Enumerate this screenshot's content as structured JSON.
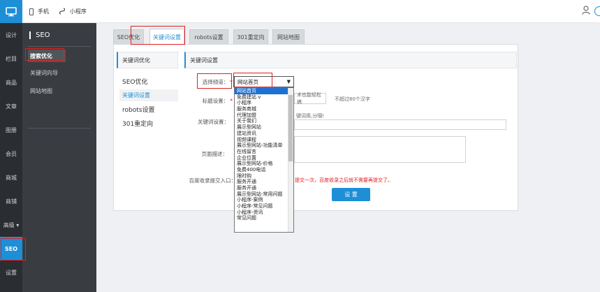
{
  "topbar": {
    "tabs": [
      {
        "label": "手机",
        "icon": "phone-icon"
      },
      {
        "label": "小程序",
        "icon": "mini-program-icon"
      }
    ]
  },
  "leftnav": {
    "items": [
      {
        "label": "设计"
      },
      {
        "label": "栏目"
      },
      {
        "label": "商品"
      },
      {
        "label": "文章"
      },
      {
        "label": "图册"
      },
      {
        "label": "会员"
      },
      {
        "label": "商城"
      },
      {
        "label": "商铺"
      },
      {
        "label": "高级 ▾"
      },
      {
        "label": "SEO"
      },
      {
        "label": "设置"
      }
    ],
    "active_index": 9
  },
  "subnav": {
    "title": "SEO",
    "items": [
      {
        "label": "搜索优化"
      },
      {
        "label": "关键词向导"
      },
      {
        "label": "网站地图"
      }
    ]
  },
  "tabs": [
    {
      "label": "SEO优化"
    },
    {
      "label": "关键词设置"
    },
    {
      "label": "robots设置"
    },
    {
      "label": "301重定向"
    },
    {
      "label": "网站地图"
    }
  ],
  "panel_left": {
    "header": "关键词优化",
    "items": [
      {
        "label": "SEO优化"
      },
      {
        "label": "关键词设置"
      },
      {
        "label": "robots设置"
      },
      {
        "label": "301重定向"
      }
    ]
  },
  "panel_right": {
    "header": "关键词设置",
    "channel_label": "选择频道：",
    "title_label": "标题设置：",
    "keyword_label": "关键词设置：",
    "desc_label": "页面描述：",
    "baidu_label": "百度收录提交入口：",
    "required_mark": "*",
    "title_value": "术也能轻松搞",
    "title_hint": "不超过80个汉字",
    "keyword_hint": "键词用,分隔!",
    "baidu_hint": "提交一次，百度收录之后就不需要再提交了。",
    "submit_label": "设 置",
    "select_value": "网站首页"
  },
  "dropdown": {
    "options": [
      "网站首页",
      "免费建站 v",
      "小程序",
      "服务商城",
      "代理加盟",
      "关于我们",
      "展示型网站",
      "建站资讯",
      "视频课程",
      "展示型网站-功能清单",
      "在线留言",
      "企业位置",
      "展示型网站-价格",
      "免费400电话",
      "限时购",
      "服务开通",
      "服务开通",
      "展示型网站-常用问题",
      "小程序-案例",
      "小程序-常见问题",
      "小程序-资讯",
      "常见问题"
    ],
    "selected_index": 0
  }
}
